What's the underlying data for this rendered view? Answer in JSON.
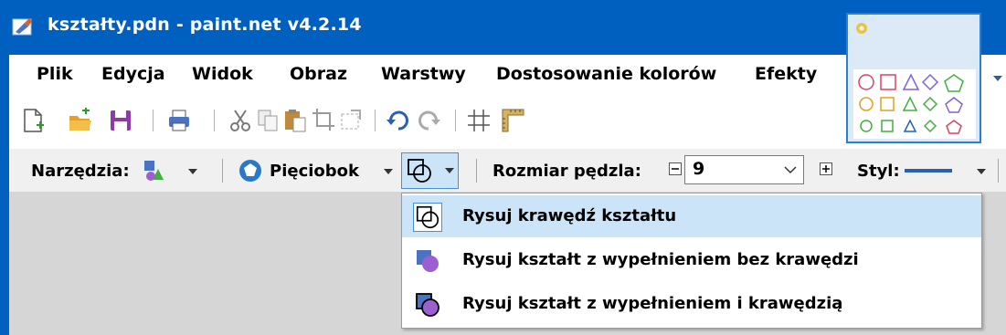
{
  "window": {
    "title": "kształty.pdn - paint.net v4.2.14"
  },
  "menu": {
    "items": [
      "Plik",
      "Edycja",
      "Widok",
      "Obraz",
      "Warstwy",
      "Dostosowanie kolorów",
      "Efekty"
    ]
  },
  "toolbar": {
    "icons": [
      "new-file-icon",
      "open-file-icon",
      "save-icon",
      "print-icon",
      "cut-icon",
      "copy-icon",
      "paste-icon",
      "crop-icon",
      "deselect-icon",
      "undo-icon",
      "redo-icon",
      "grid-icon",
      "ruler-icon"
    ]
  },
  "tool_options": {
    "tools_label": "Narzędzia:",
    "shape_label": "Pięciobok",
    "brush_size_label": "Rozmiar pędzla:",
    "brush_size_value": "9",
    "style_label": "Styl:"
  },
  "draw_mode_menu": {
    "items": [
      {
        "label": "Rysuj krawędź kształtu",
        "icon": "shape-outline-icon",
        "selected": true
      },
      {
        "label": "Rysuj kształt z wypełnieniem bez krawędzi",
        "icon": "shape-fill-icon",
        "selected": false
      },
      {
        "label": "Rysuj kształt z wypełnieniem i krawędzią",
        "icon": "shape-fill-outline-icon",
        "selected": false
      }
    ]
  },
  "colors": {
    "titlebar": "#0060c0",
    "highlight": "#cce4f7",
    "fill_blue": "#4a73c4",
    "fill_purple": "#9b5fcf"
  }
}
